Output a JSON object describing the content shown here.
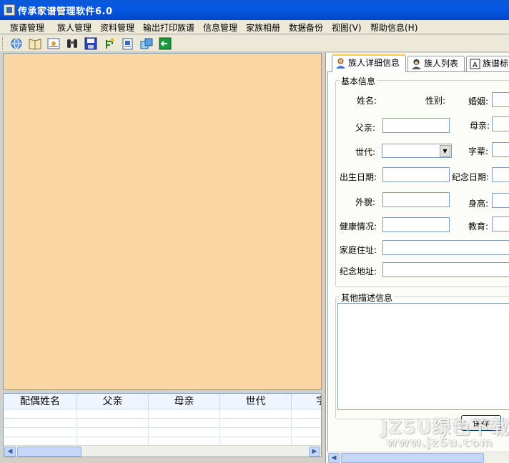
{
  "window": {
    "title": "传承家谱管理软件6.0"
  },
  "menu": [
    {
      "label": "族谱管理"
    },
    {
      "label": "族人管理"
    },
    {
      "label": "资料管理"
    },
    {
      "label": "输出打印族谱"
    },
    {
      "label": "信息管理"
    },
    {
      "label": "家族相册"
    },
    {
      "label": "数据备份"
    },
    {
      "label": "视图(V)"
    },
    {
      "label": "帮助信息(H)"
    }
  ],
  "toolbar": {
    "icons": [
      "globe-icon",
      "book-icon",
      "certificate-icon",
      "binoculars-icon",
      "save-disk-icon",
      "tree-branch-icon",
      "document-print-icon",
      "windows-cascade-icon",
      "exit-icon"
    ]
  },
  "grid": {
    "columns": [
      "配偶姓名",
      "父亲",
      "母亲",
      "世代",
      "字"
    ]
  },
  "tabs": [
    {
      "label": "族人详细信息"
    },
    {
      "label": "族人列表"
    },
    {
      "label": "族谱标"
    }
  ],
  "form": {
    "group_basic": "基本信息",
    "name_label": "姓名:",
    "gender_label": "性别:",
    "marriage_label": "婚姻:",
    "father_label": "父亲:",
    "mother_label": "母亲:",
    "generation_label": "世代:",
    "courtesy_label": "字辈:",
    "birth_label": "出生日期:",
    "memorial_date_label": "纪念日期:",
    "appearance_label": "外貌:",
    "height_label": "身高:",
    "health_label": "健康情况:",
    "education_label": "教育:",
    "address_label": "家庭住址:",
    "memorial_address_label": "纪念地址:",
    "group_other": "其他描述信息",
    "save_label": "保存"
  },
  "watermark": {
    "line1": "JZ5U绿色下载",
    "line2": "www.jz5u.com"
  },
  "colors": {
    "titlebar": "#0558e4",
    "canvas": "#fad6a5",
    "tab_highlight": "#ffc83c"
  }
}
